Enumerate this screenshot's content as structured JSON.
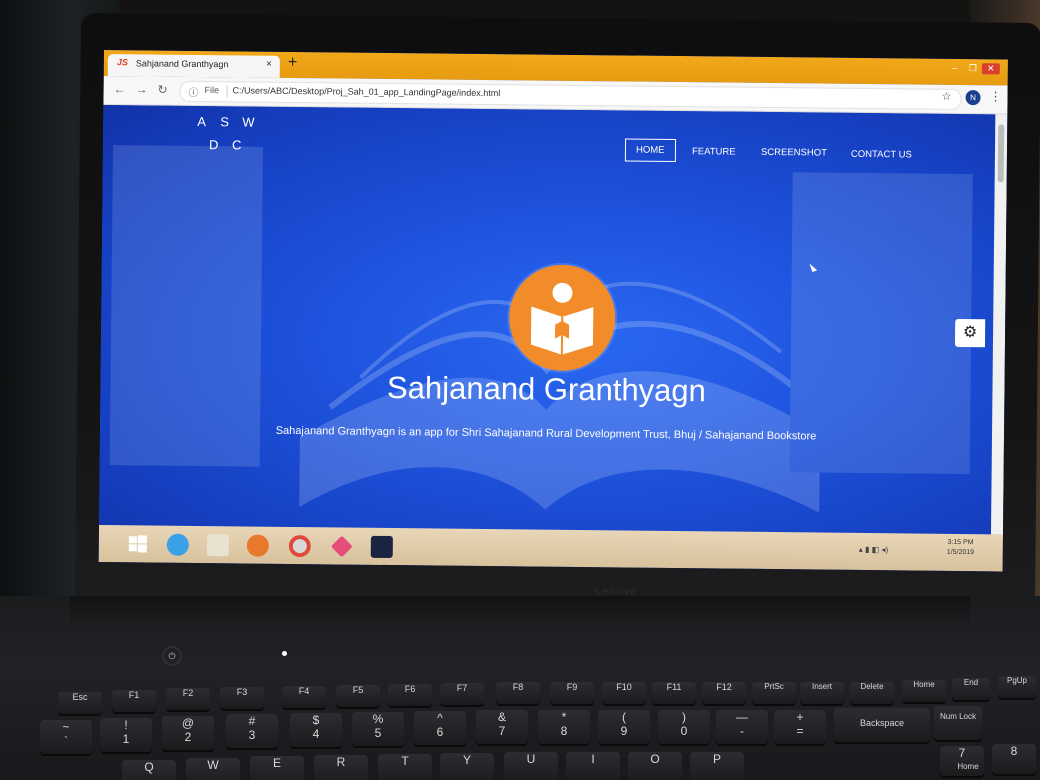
{
  "browser": {
    "tab_logo": "JS",
    "tab_title": "Sahjanand Granthyagn",
    "tab_close": "×",
    "new_tab": "+",
    "info_icon": "ⓘ",
    "file_label": "File",
    "url": "C:/Users/ABC/Desktop/Proj_Sah_01_app_LandingPage/index.html",
    "profile_initial": "N"
  },
  "site": {
    "logo": {
      "row1": [
        "A",
        "S",
        "W"
      ],
      "row2": [
        "D",
        "C"
      ]
    },
    "nav": {
      "home": "HOME",
      "feature": "FEATURE",
      "screenshot": "SCREENSHOT",
      "contact": "CONTACT US"
    },
    "hero": {
      "title": "Sahjanand Granthyagn",
      "subtitle": "Sahajanand Granthyagn is an app for Shri Sahajanand Rural Development Trust, Bhuj / Sahajanand Bookstore"
    }
  },
  "taskbar": {
    "clock_time": "3:15 PM",
    "clock_date": "1/5/2019"
  },
  "laptop": {
    "brand": "Lenovo"
  },
  "keyboard": {
    "function_row": [
      "Esc",
      "F1",
      "F2",
      "F3",
      "F4",
      "F5",
      "F6",
      "F7",
      "F8",
      "F9",
      "F10",
      "F11",
      "F12",
      "PrtSc",
      "Insert",
      "Delete",
      "Home",
      "End",
      "PgUp"
    ],
    "number_row": [
      "~",
      "!",
      "@",
      "#",
      "$",
      "%",
      "^",
      "&",
      "*",
      "(",
      ")",
      "—",
      "+",
      "Backspace",
      "Num Lock"
    ],
    "number_row_digits": [
      "`",
      "1",
      "2",
      "3",
      "4",
      "5",
      "6",
      "7",
      "8",
      "9",
      "0",
      "-",
      "="
    ],
    "letter_row": [
      "Q",
      "W",
      "E",
      "R",
      "T",
      "Y",
      "U",
      "I",
      "O",
      "P"
    ],
    "numpad": [
      "7",
      "8",
      "Home"
    ]
  },
  "colors": {
    "accent_orange": "#f28c2a",
    "hero_blue": "#1f55e0",
    "chrome_titlebar": "#f1a81a"
  }
}
